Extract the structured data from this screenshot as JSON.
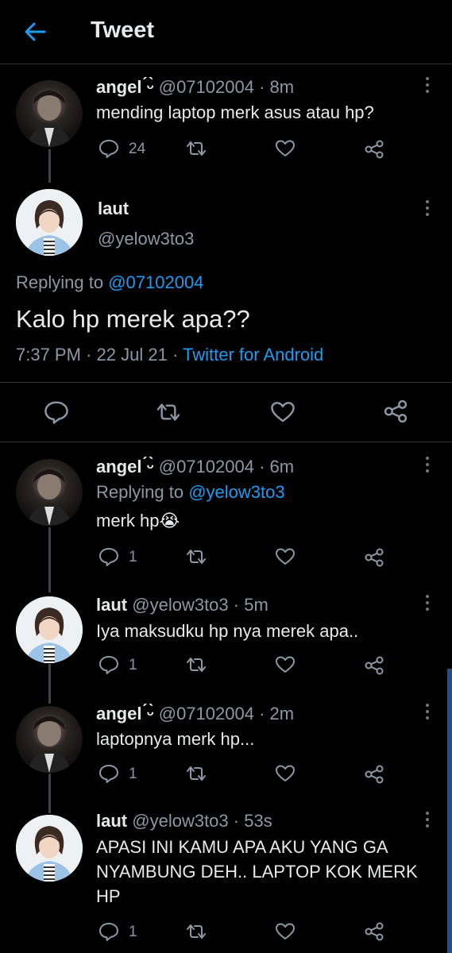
{
  "header": {
    "title": "Tweet"
  },
  "tweets": [
    {
      "name": "angel ́ᵕ̀",
      "handle": "@07102004",
      "time": "8m",
      "text": "mending laptop merk asus atau hp?",
      "reply_count": "24"
    },
    {
      "name": "angel ́ᵕ̀",
      "handle": "@07102004",
      "time": "6m",
      "replying_label": "Replying to",
      "replying_to": "@yelow3to3",
      "text": "merk hp😭",
      "reply_count": "1"
    },
    {
      "name": "laut",
      "handle": "@yelow3to3",
      "time": "5m",
      "text": "Iya maksudku hp nya merek apa..",
      "reply_count": "1"
    },
    {
      "name": "angel ́ᵕ̀",
      "handle": "@07102004",
      "time": "2m",
      "text": "laptopnya merk hp...",
      "reply_count": "1"
    },
    {
      "name": "laut",
      "handle": "@yelow3to3",
      "time": "53s",
      "text": "APASI INI KAMU APA AKU YANG GA NYAMBUNG DEH.. LAPTOP KOK MERK HP",
      "reply_count": "1"
    }
  ],
  "main_tweet": {
    "name": "laut",
    "handle": "@yelow3to3",
    "replying_label": "Replying to",
    "replying_to": "@07102004",
    "text": "Kalo hp merek apa??",
    "time": "7:37 PM",
    "date": "22 Jul 21",
    "source": "Twitter for Android"
  },
  "separator": "·",
  "colors": {
    "accent": "#1d9bf0",
    "muted": "#8b98a5",
    "background": "#000000"
  }
}
